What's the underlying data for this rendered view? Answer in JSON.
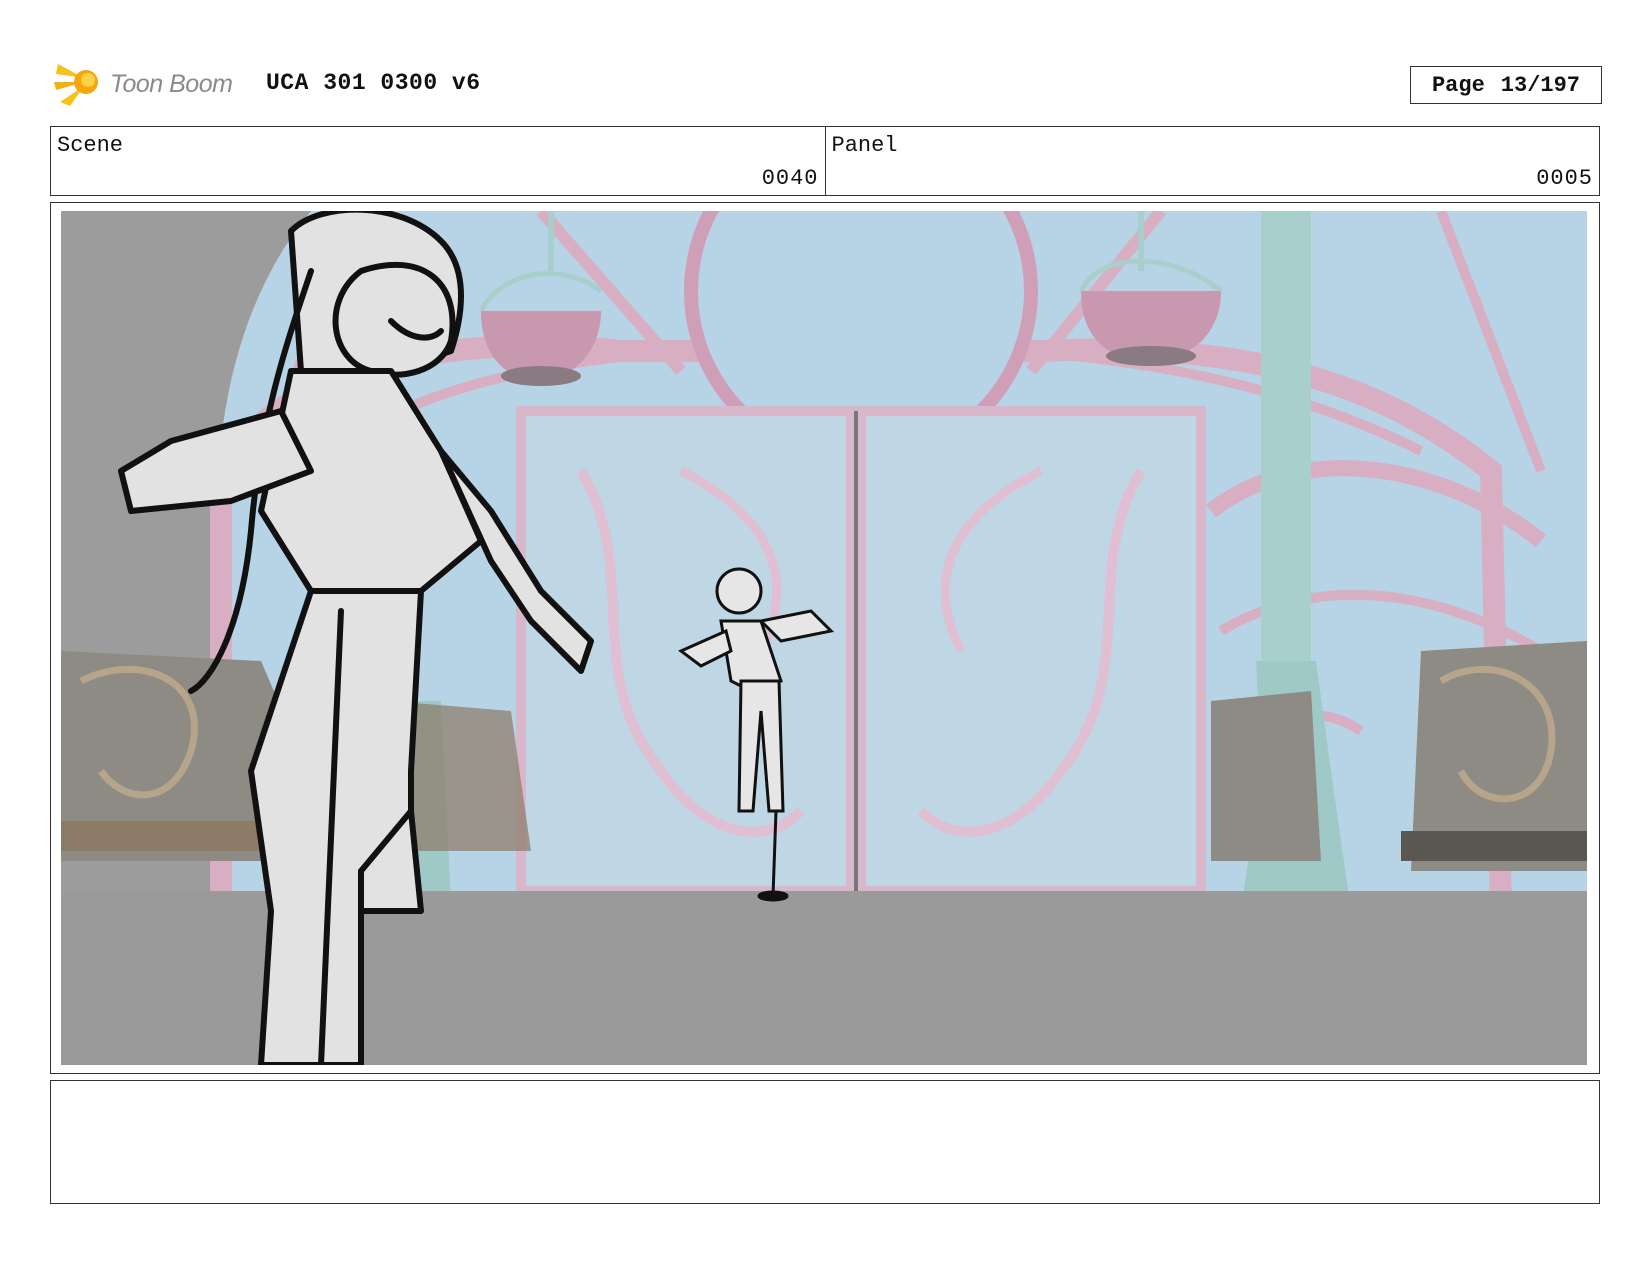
{
  "header": {
    "logo_text": "Toon Boom",
    "doc_title": "UCA 301 0300 v6",
    "page_label": "Page",
    "page_value": "13/197"
  },
  "info": {
    "scene_label": "Scene",
    "scene_value": "0040",
    "panel_label": "Panel",
    "panel_value": "0005"
  },
  "notes": {
    "text": ""
  }
}
